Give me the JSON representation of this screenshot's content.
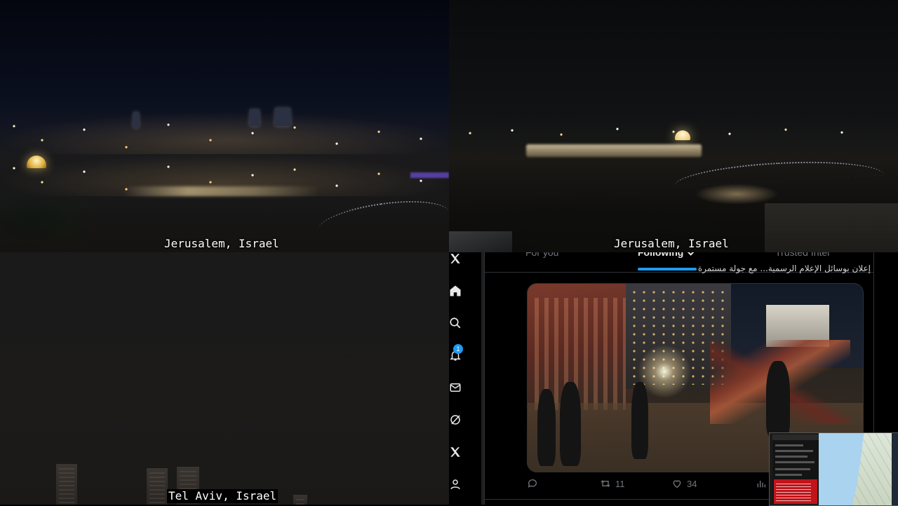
{
  "feeds": {
    "top_left": {
      "caption": "Jerusalem, Israel"
    },
    "top_right": {
      "caption": "Jerusalem, Israel"
    },
    "bottom_left": {
      "caption": "Tel Aviv, Israel"
    }
  },
  "x_app": {
    "rail_icons": [
      "x-logo-icon",
      "home-icon",
      "search-icon",
      "notifications-icon",
      "messages-icon",
      "grok-icon",
      "x-premium-icon",
      "profile-icon"
    ],
    "notification_count": "1",
    "tabs": [
      {
        "label": "For you",
        "active": false
      },
      {
        "label": "Following",
        "active": true
      },
      {
        "label": "Trusted Intel",
        "active": false
      }
    ],
    "post": {
      "text": "إعلان بوسائل الإعلام الرسمية... مع جولة مستمرة",
      "actions": {
        "replies": "",
        "reposts": "11",
        "likes": "34"
      }
    },
    "colors": {
      "accent": "#1d9bf0",
      "text": "#e7e9ea",
      "muted": "#71767b",
      "border": "#2f3336"
    }
  },
  "map_thumbnail": {
    "colors": {
      "sea": "#a9d3ef",
      "alert": "#c0141a"
    }
  }
}
